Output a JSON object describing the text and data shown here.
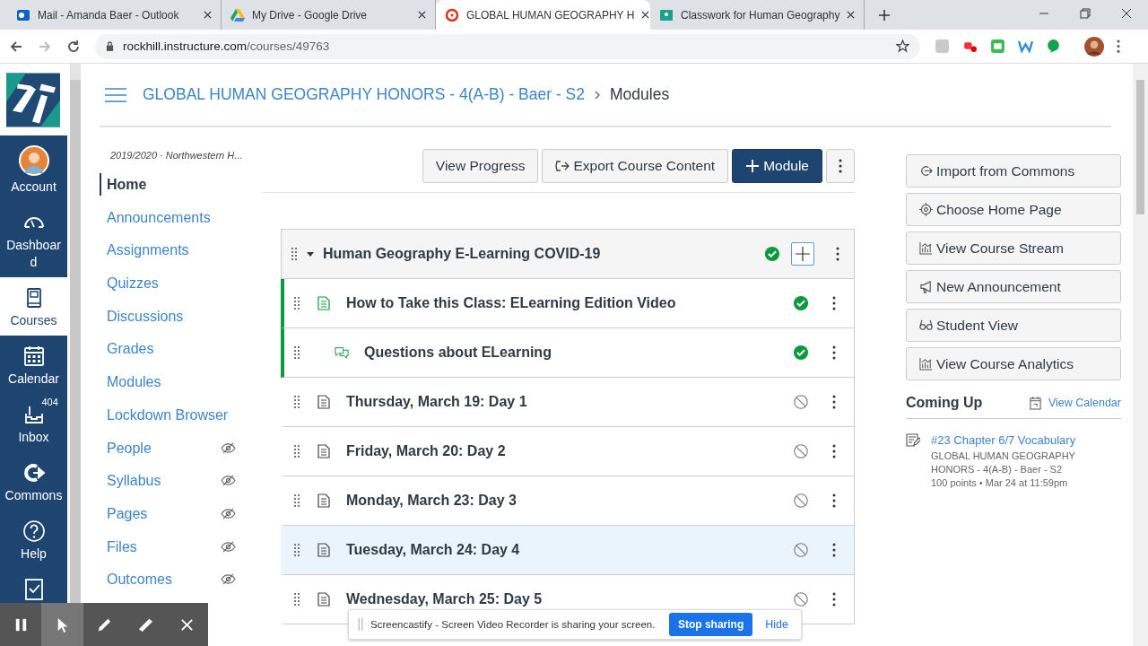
{
  "browser": {
    "tabs": [
      {
        "title": "Mail - Amanda Baer - Outlook",
        "kind": "mail",
        "selected": false
      },
      {
        "title": "My Drive - Google Drive",
        "kind": "drive",
        "selected": false
      },
      {
        "title": "GLOBAL HUMAN GEOGRAPHY H",
        "kind": "canvas",
        "selected": true
      },
      {
        "title": "Classwork for Human Geography",
        "kind": "classroom",
        "selected": false
      }
    ],
    "url_host": "rockhill.instructure.com",
    "url_path": "/courses/49763"
  },
  "global_nav": {
    "items": [
      {
        "kind": "account",
        "label": "Account",
        "selected": false
      },
      {
        "kind": "dashboard",
        "label": "Dashboard",
        "selected": false
      },
      {
        "kind": "courses",
        "label": "Courses",
        "selected": true
      },
      {
        "kind": "calendar",
        "label": "Calendar",
        "selected": false
      },
      {
        "kind": "inbox",
        "label": "Inbox",
        "badge": "404",
        "selected": false
      },
      {
        "kind": "commons",
        "label": "Commons",
        "selected": false
      },
      {
        "kind": "help",
        "label": "Help",
        "selected": false
      },
      {
        "kind": "gradebook",
        "selected": false
      }
    ]
  },
  "header": {
    "course": "GLOBAL HUMAN GEOGRAPHY HONORS - 4(A-B) - Baer - S2",
    "page": "Modules"
  },
  "course_nav": {
    "term": "2019/2020 · Northwestern H...",
    "items": [
      {
        "label": "Home",
        "selected": true,
        "hidden": false
      },
      {
        "label": "Announcements",
        "selected": false,
        "hidden": false
      },
      {
        "label": "Assignments",
        "selected": false,
        "hidden": false
      },
      {
        "label": "Quizzes",
        "selected": false,
        "hidden": false
      },
      {
        "label": "Discussions",
        "selected": false,
        "hidden": false
      },
      {
        "label": "Grades",
        "selected": false,
        "hidden": false
      },
      {
        "label": "Modules",
        "selected": false,
        "hidden": false
      },
      {
        "label": "Lockdown Browser",
        "selected": false,
        "hidden": false
      },
      {
        "label": "People",
        "selected": false,
        "hidden": true
      },
      {
        "label": "Syllabus",
        "selected": false,
        "hidden": true
      },
      {
        "label": "Pages",
        "selected": false,
        "hidden": true
      },
      {
        "label": "Files",
        "selected": false,
        "hidden": true
      },
      {
        "label": "Outcomes",
        "selected": false,
        "hidden": true
      }
    ]
  },
  "toolbar": {
    "buttons": [
      {
        "label": "View Progress",
        "kind": "plain"
      },
      {
        "label": "Export Course Content",
        "kind": "export"
      },
      {
        "label": "Module",
        "kind": "primary"
      },
      {
        "kind": "more"
      }
    ]
  },
  "module": {
    "title": "Human Geography E-Learning COVID-19",
    "published": true,
    "expanded": true,
    "items": [
      {
        "title": "How to Take this Class: ELearning Edition Video",
        "kind": "page",
        "published": true,
        "indented": false,
        "highlighted": false
      },
      {
        "title": "Questions about ELearning",
        "kind": "discussion",
        "published": true,
        "indented": true,
        "highlighted": false
      },
      {
        "title": "Thursday, March 19: Day 1",
        "kind": "page",
        "published": false,
        "indented": false,
        "highlighted": false
      },
      {
        "title": "Friday, March 20: Day 2",
        "kind": "page",
        "published": false,
        "indented": false,
        "highlighted": false
      },
      {
        "title": "Monday, March 23: Day 3",
        "kind": "page",
        "published": false,
        "indented": false,
        "highlighted": false
      },
      {
        "title": "Tuesday, March 24: Day 4",
        "kind": "page",
        "published": false,
        "indented": false,
        "highlighted": true
      },
      {
        "title": "Wednesday, March 25: Day 5",
        "kind": "page",
        "published": false,
        "indented": false,
        "highlighted": false
      }
    ]
  },
  "sidebar": {
    "buttons": [
      {
        "label": "Import from Commons",
        "kind": "commons"
      },
      {
        "label": "Choose Home Page",
        "kind": "target"
      },
      {
        "label": "View Course Stream",
        "kind": "chart"
      },
      {
        "label": "New Announcement",
        "kind": "megaphone"
      },
      {
        "label": "Student View",
        "kind": "glasses"
      },
      {
        "label": "View Course Analytics",
        "kind": "chart"
      }
    ],
    "coming_up": {
      "heading": "Coming Up",
      "link": "View Calendar",
      "items": [
        {
          "title": "#23 Chapter 6/7 Vocabulary",
          "course": "GLOBAL HUMAN GEOGRAPHY HONORS - 4(A-B) - Baer - S2",
          "meta": "100 points • Mar 24 at 11:59pm"
        }
      ]
    }
  },
  "recorder": {
    "tools": [
      {
        "kind": "pause",
        "selected": false
      },
      {
        "kind": "pointer",
        "selected": true
      },
      {
        "kind": "pen",
        "selected": false
      },
      {
        "kind": "eraser",
        "selected": false
      },
      {
        "kind": "close",
        "selected": false
      }
    ],
    "notice": "Screencastify - Screen Video Recorder is sharing your screen.",
    "stop": "Stop sharing",
    "hide": "Hide"
  }
}
